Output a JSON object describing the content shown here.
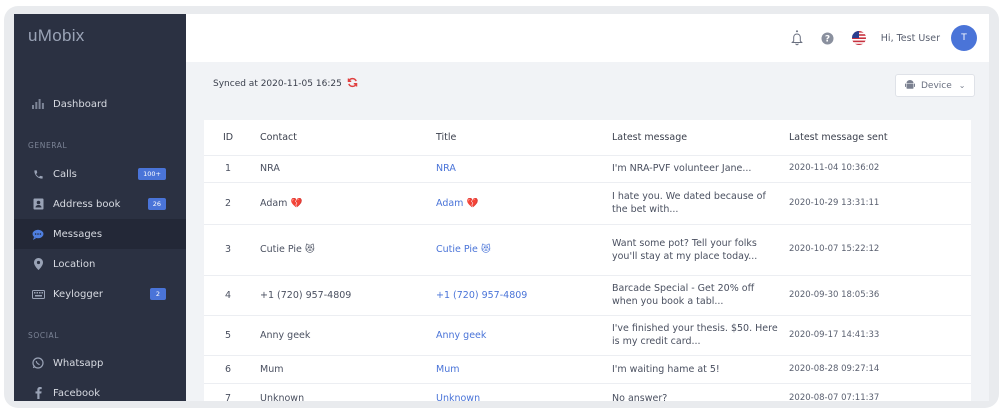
{
  "app": {
    "logo": "uMobix"
  },
  "sidebar": {
    "dashboard": {
      "label": "Dashboard",
      "icon": "bar-chart-icon"
    },
    "general_label": "GENERAL",
    "social_label": "SOCIAL",
    "items": [
      {
        "label": "Calls",
        "icon": "phone-icon",
        "badge": "100+"
      },
      {
        "label": "Address book",
        "icon": "address-book-icon",
        "badge": "26"
      },
      {
        "label": "Messages",
        "icon": "chat-icon",
        "active": true
      },
      {
        "label": "Location",
        "icon": "location-pin-icon"
      },
      {
        "label": "Keylogger",
        "icon": "keyboard-icon",
        "badge": "2"
      },
      {
        "label": "Whatsapp",
        "icon": "whatsapp-icon"
      },
      {
        "label": "Facebook",
        "icon": "facebook-icon"
      }
    ]
  },
  "topbar": {
    "greeting": "Hi, Test User",
    "avatar_initial": "T"
  },
  "sync": {
    "text": "Synced at 2020-11-05 16:25"
  },
  "device_select": {
    "value": "Device"
  },
  "table": {
    "headers": {
      "id": "ID",
      "contact": "Contact",
      "title": "Title",
      "latest": "Latest message",
      "sent": "Latest message sent"
    },
    "rows": [
      {
        "id": "1",
        "contact": "NRA",
        "title": "NRA",
        "message": "I'm NRA-PVF volunteer Jane...",
        "sent": "2020-11-04 10:36:02"
      },
      {
        "id": "2",
        "contact": "Adam 💔",
        "title": "Adam 💔",
        "message": "I hate you. We dated because of the bet with...",
        "sent": "2020-10-29 13:31:11"
      },
      {
        "id": "3",
        "contact": "Cutie Pie 😻",
        "title": "Cutie Pie 😻",
        "message": "Want some pot? Tell your folks you'll stay at my place today...",
        "sent": "2020-10-07 15:22:12"
      },
      {
        "id": "4",
        "contact": "+1 (720) 957-4809",
        "title": "+1 (720) 957-4809",
        "message": "Barcade Special - Get 20% off when you book a tabl...",
        "sent": "2020-09-30 18:05:36"
      },
      {
        "id": "5",
        "contact": "Anny geek",
        "title": "Anny geek",
        "message": "I've finished your thesis. $50. Here is my credit card...",
        "sent": "2020-09-17 14:41:33"
      },
      {
        "id": "6",
        "contact": "Mum",
        "title": "Mum",
        "message": "I'm waiting hame at 5!",
        "sent": "2020-08-28 09:27:14"
      },
      {
        "id": "7",
        "contact": "Unknown",
        "title": "Unknown",
        "message": "No answer?",
        "sent": "2020-08-07 07:11:37"
      }
    ]
  }
}
